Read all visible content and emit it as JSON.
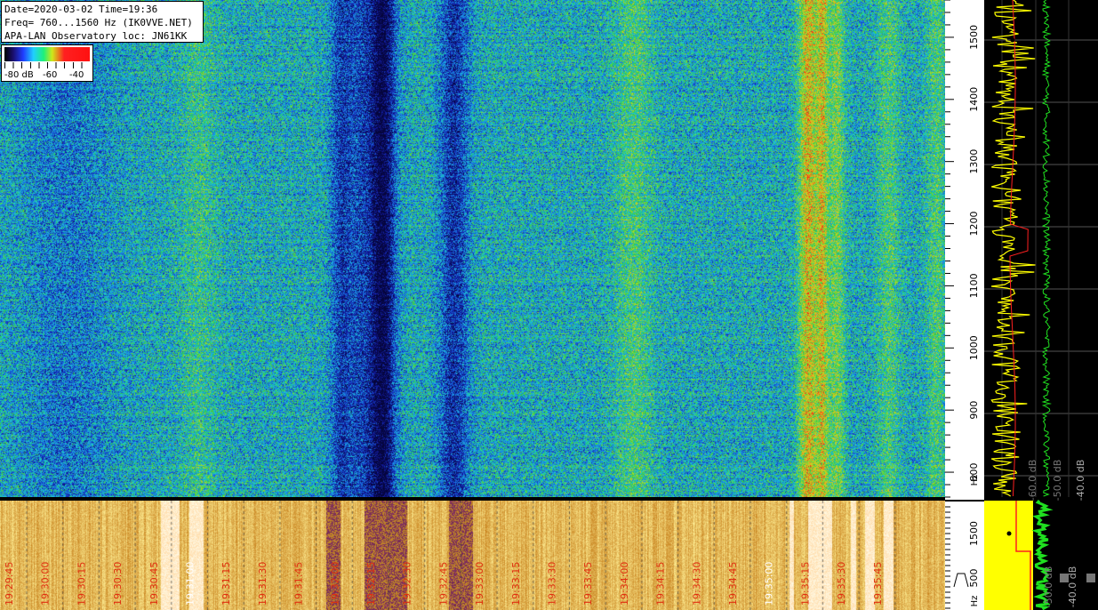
{
  "info": {
    "line1": "Date=2020-03-02 Time=19:36",
    "line2": "Freq= 760...1560 Hz (IK0VVE.NET)",
    "line3": "APA-LAN Observatory loc: JN61KK"
  },
  "colorbar": {
    "labels": [
      "-80 dB",
      "-60",
      "-40"
    ]
  },
  "chart_data": [
    {
      "type": "heatmap",
      "title": "",
      "x_axis": "time",
      "y_axis": "frequency",
      "ylim": [
        760,
        1560
      ],
      "y_ticks": [
        "800",
        "900",
        "1000",
        "1100",
        "1200",
        "1300",
        "1400",
        "1500"
      ],
      "y_unit": "Hz",
      "colorbar_range_db": [
        -80,
        -40
      ],
      "bright_band_x_fraction": [
        0.835,
        0.875
      ],
      "dark_band_x_fraction": [
        0.37,
        0.43
      ]
    },
    {
      "type": "heatmap",
      "title": "",
      "x_tick_labels": [
        "19:29:45",
        "19:30:00",
        "19:30:15",
        "19:30:30",
        "19:30:45",
        "19:31:00",
        "19:31:15",
        "19:31:30",
        "19:31:45",
        "19:32:00",
        "19:32:15",
        "19:32:30",
        "19:32:45",
        "19:33:00",
        "19:33:15",
        "19:33:30",
        "19:33:45",
        "19:34:00",
        "19:34:15",
        "19:34:30",
        "19:34:45",
        "19:35:00",
        "19:35:15",
        "19:35:30",
        "19:35:45"
      ],
      "y_ticks": [
        "500",
        "1500"
      ],
      "y_unit": "Hz"
    },
    {
      "type": "line",
      "series": [
        {
          "values": []
        }
      ],
      "x_axis_labels": [
        "-40.0 dB",
        "-50.0 dB",
        "-60.0 dB"
      ],
      "colors": {
        "trace": "#ffff00",
        "line": "#ff2020",
        "level": "#20e020"
      }
    },
    {
      "type": "line",
      "x_axis_labels": [
        "-40.0 dB",
        "-50.0 dB",
        "-60.0 dB"
      ]
    }
  ],
  "colors": {
    "bottom_time_label": "#e03010",
    "bottom_time_label_alt": "#ffffff"
  }
}
